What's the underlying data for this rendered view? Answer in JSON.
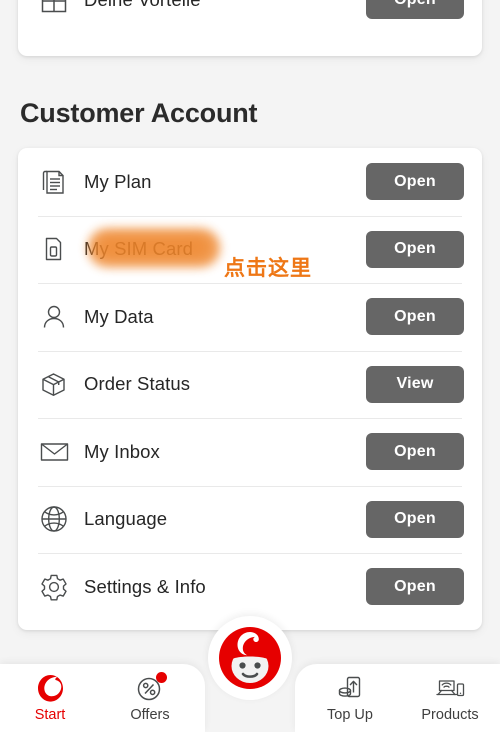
{
  "app": {
    "background_color": "#f4f4f4",
    "brand_color": "#e60000",
    "button_color": "#666666",
    "annotation_color": "#ee7716"
  },
  "top_card": {
    "rows": [
      {
        "icon": "gift-icon",
        "label": "Deine Vorteile",
        "action": "Open"
      }
    ]
  },
  "section": {
    "title": "Customer Account"
  },
  "account_card": {
    "rows": [
      {
        "icon": "documents-icon",
        "label": "My Plan",
        "action": "Open"
      },
      {
        "icon": "sim-card-icon",
        "label": "My SIM Card",
        "action": "Open"
      },
      {
        "icon": "person-icon",
        "label": "My Data",
        "action": "Open"
      },
      {
        "icon": "package-icon",
        "label": "Order Status",
        "action": "View"
      },
      {
        "icon": "envelope-icon",
        "label": "My Inbox",
        "action": "Open"
      },
      {
        "icon": "globe-icon",
        "label": "Language",
        "action": "Open"
      },
      {
        "icon": "gear-icon",
        "label": "Settings & Info",
        "action": "Open"
      }
    ]
  },
  "annotation": {
    "text": "点击这里",
    "target_label": "My SIM Card",
    "highlight_color": "#f08a32"
  },
  "bottom_nav": {
    "items": [
      {
        "id": "start",
        "icon": "vodafone-logo-icon",
        "label": "Start",
        "active": true,
        "badge": false
      },
      {
        "id": "offers",
        "icon": "percent-circle-icon",
        "label": "Offers",
        "active": false,
        "badge": true
      },
      {
        "id": "topup",
        "icon": "top-up-icon",
        "label": "Top Up",
        "active": false,
        "badge": false
      },
      {
        "id": "products",
        "icon": "router-phone-icon",
        "label": "Products",
        "active": false,
        "badge": false
      }
    ],
    "assistant": {
      "icon": "tobi-avatar-icon",
      "label": ""
    }
  }
}
